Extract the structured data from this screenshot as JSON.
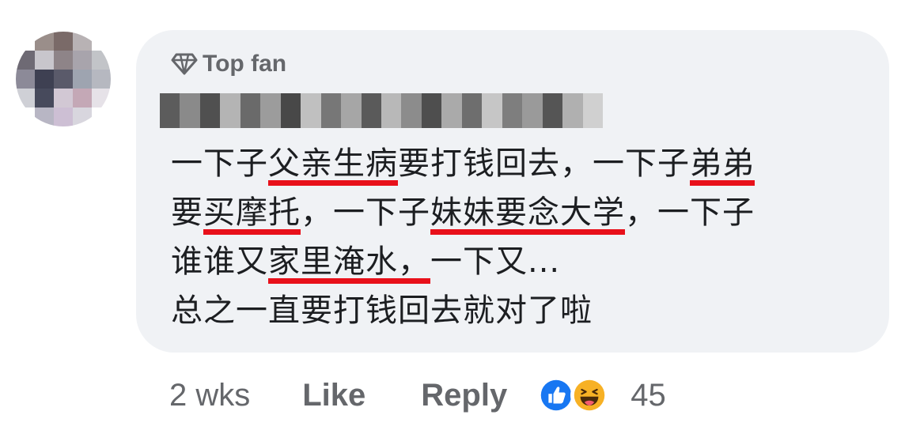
{
  "comment": {
    "badge_label": "Top fan",
    "lines": [
      [
        {
          "t": "一下子",
          "hl": false
        },
        {
          "t": "父亲生病",
          "hl": true
        },
        {
          "t": "要打钱回去，一下子",
          "hl": false
        },
        {
          "t": "弟弟",
          "hl": true
        }
      ],
      [
        {
          "t": "要",
          "hl": false
        },
        {
          "t": "买摩托",
          "hl": true
        },
        {
          "t": "，一下子",
          "hl": false
        },
        {
          "t": "妹妹要念大学",
          "hl": true
        },
        {
          "t": "，一下子",
          "hl": false
        }
      ],
      [
        {
          "t": "谁谁又",
          "hl": false
        },
        {
          "t": "家里淹水，",
          "hl": true
        },
        {
          "t": "一下又...",
          "hl": false
        }
      ],
      [
        {
          "t": "总之一直要打钱回去就对了啦",
          "hl": false
        }
      ]
    ]
  },
  "footer": {
    "time": "2 wks",
    "like_label": "Like",
    "reply_label": "Reply",
    "reaction_count": "45",
    "reactions": [
      "like-reaction-icon",
      "haha-reaction-icon"
    ]
  },
  "colors": {
    "bubble_bg": "#f0f2f5",
    "secondary_text": "#65676b",
    "highlight_underline": "#e8101a",
    "like_blue": "#1877f2",
    "haha_yellow": "#f7b125"
  }
}
